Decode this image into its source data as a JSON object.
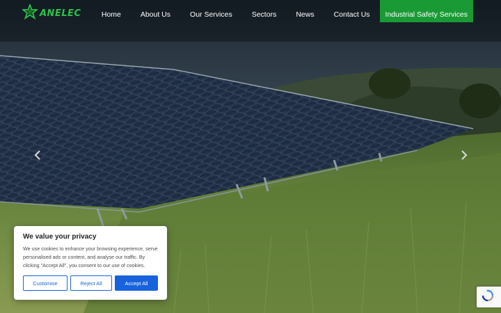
{
  "header": {
    "logo_text": "ANELEC",
    "nav": [
      {
        "label": "Home"
      },
      {
        "label": "About Us"
      },
      {
        "label": "Our Services"
      },
      {
        "label": "Sectors"
      },
      {
        "label": "News"
      },
      {
        "label": "Contact Us"
      },
      {
        "label": "Industrial Safety Services"
      }
    ]
  },
  "hero": {
    "prev_icon": "chevron-left-icon",
    "next_icon": "chevron-right-icon"
  },
  "cookie": {
    "title": "We value your privacy",
    "text": "We use cookies to enhance your browsing experience, serve personalised ads or content, and analyse our traffic. By clicking \"Accept All\", you consent to our use of cookies.",
    "customise_label": "Customise",
    "reject_label": "Reject All",
    "accept_label": "Accept All"
  },
  "colors": {
    "brand_green": "#1a9a35",
    "accent_blue": "#1863dc"
  }
}
